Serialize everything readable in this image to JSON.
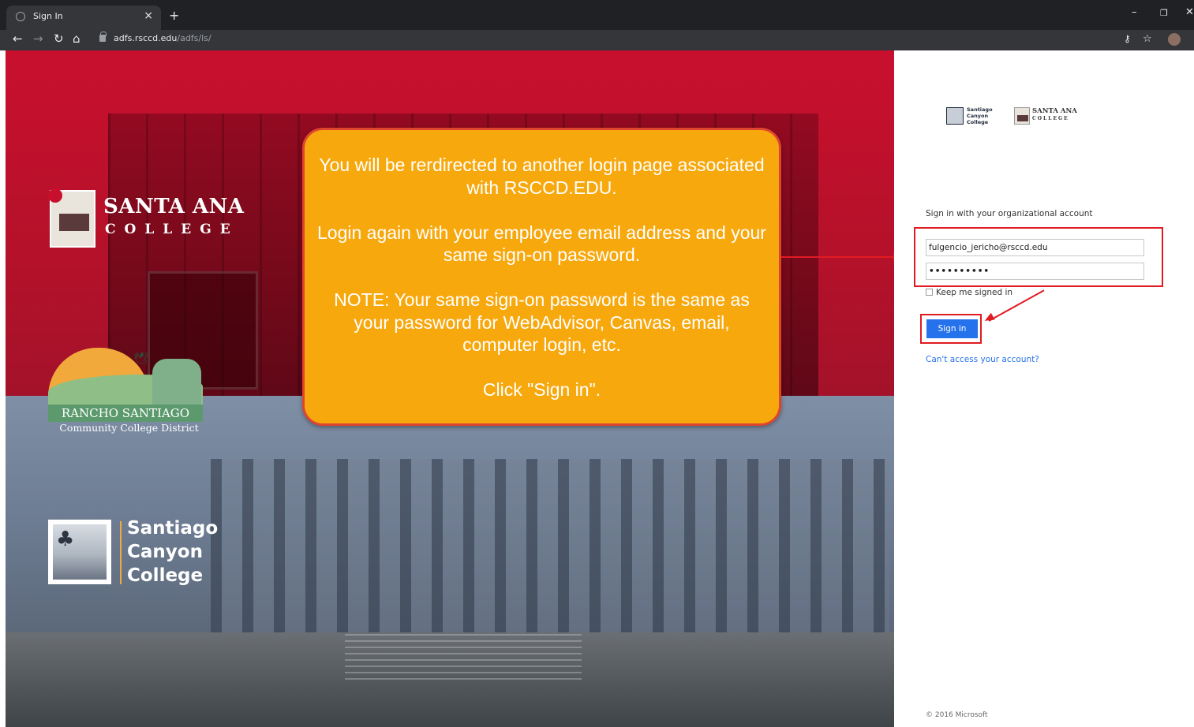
{
  "browser": {
    "tab_title": "Sign In",
    "tab_close": "×",
    "new_tab": "+",
    "url_host": "adfs.rsccd.edu",
    "url_path": "/adfs/ls/",
    "minimize": "–",
    "restore": "❐",
    "close": "✕"
  },
  "hero": {
    "santa_ana_name": "SANTA ANA",
    "santa_ana_sub": "COLLEGE",
    "rancho_name": "RANCHO SANTIAGO",
    "rancho_sub": "Community College District",
    "scc_line1": "Santiago",
    "scc_line2": "Canyon",
    "scc_line3": "College"
  },
  "callout": {
    "para1": "You will be rerdirected to another login page associated with RSCCD.EDU.",
    "para2": "Login again with your employee email address and your same sign-on password.",
    "para3": "NOTE:  Your same sign-on password is the same as your password for WebAdvisor, Canvas, email, computer login, etc.",
    "para4": "Click \"Sign in\"."
  },
  "panel": {
    "scc_logo_l1": "Santiago",
    "scc_logo_l2": "Canyon",
    "scc_logo_l3": "College",
    "sa_logo_l1": "SANTA ANA",
    "sa_logo_l2": "COLLEGE",
    "heading": "Sign in with your organizational account",
    "email_value": "fulgencio_jericho@rsccd.edu",
    "password_value": "••••••••••",
    "keep_signed_in": "Keep me signed in",
    "sign_in_button": "Sign in",
    "cant_access": "Can't access your account?",
    "footer": "© 2016 Microsoft"
  },
  "colors": {
    "accent_blue": "#2672ec",
    "highlight_red": "#e11b22",
    "callout_orange": "#f7a80d"
  }
}
